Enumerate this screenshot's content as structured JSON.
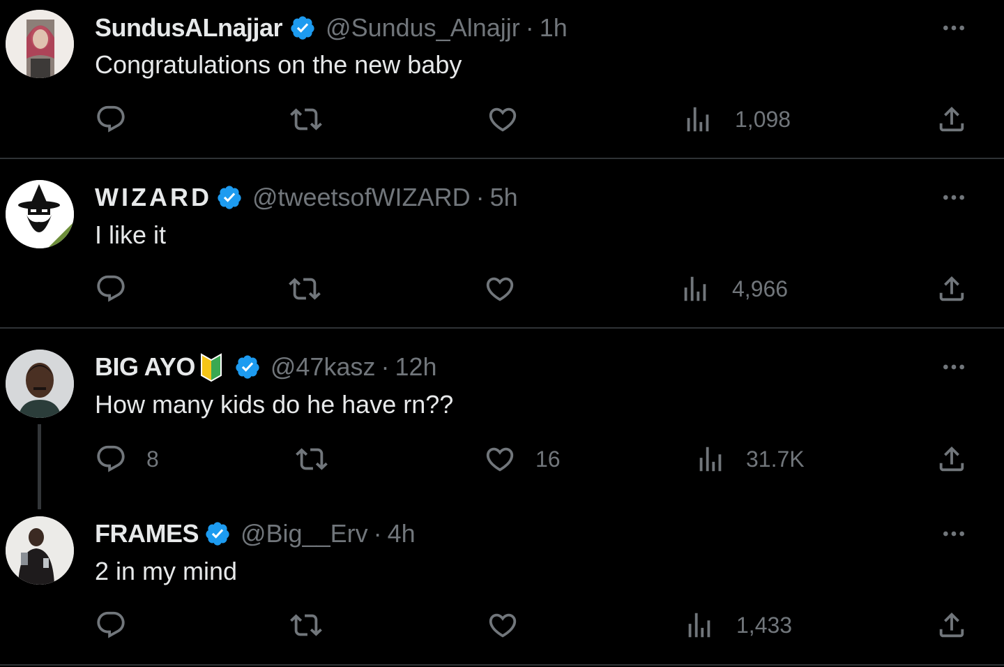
{
  "replies": [
    {
      "name": "SundusALnajjar",
      "handle": "@Sundus_Alnajjr",
      "sep": "·",
      "time": "1h",
      "text": "Congratulations on the new baby",
      "reply_count": "",
      "like_count": "",
      "views": "1,098"
    },
    {
      "name": "WIZARD",
      "handle": "@tweetsofWIZARD",
      "sep": "·",
      "time": "5h",
      "text": "I like it",
      "reply_count": "",
      "like_count": "",
      "views": "4,966"
    },
    {
      "name": "BIG AYO",
      "handle": "@47kasz",
      "sep": "·",
      "time": "12h",
      "text": "How many kids do he have rn??",
      "reply_count": "8",
      "like_count": "16",
      "views": "31.7K"
    },
    {
      "name": "FRAMES",
      "handle": "@Big__Erv",
      "sep": "·",
      "time": "4h",
      "text": "2 in my mind",
      "reply_count": "",
      "like_count": "",
      "views": "1,433"
    }
  ],
  "icons": {
    "verified": "verified-badge-icon",
    "beginner": "beginner-mark-icon",
    "more": "more-icon",
    "reply": "reply-icon",
    "retweet": "retweet-icon",
    "like": "heart-icon",
    "views": "views-icon",
    "share": "share-icon"
  },
  "colors": {
    "background": "#000000",
    "text_primary": "#e7e9ea",
    "text_secondary": "#71767b",
    "verified_blue": "#1d9bf0",
    "divider": "#2f3336"
  }
}
